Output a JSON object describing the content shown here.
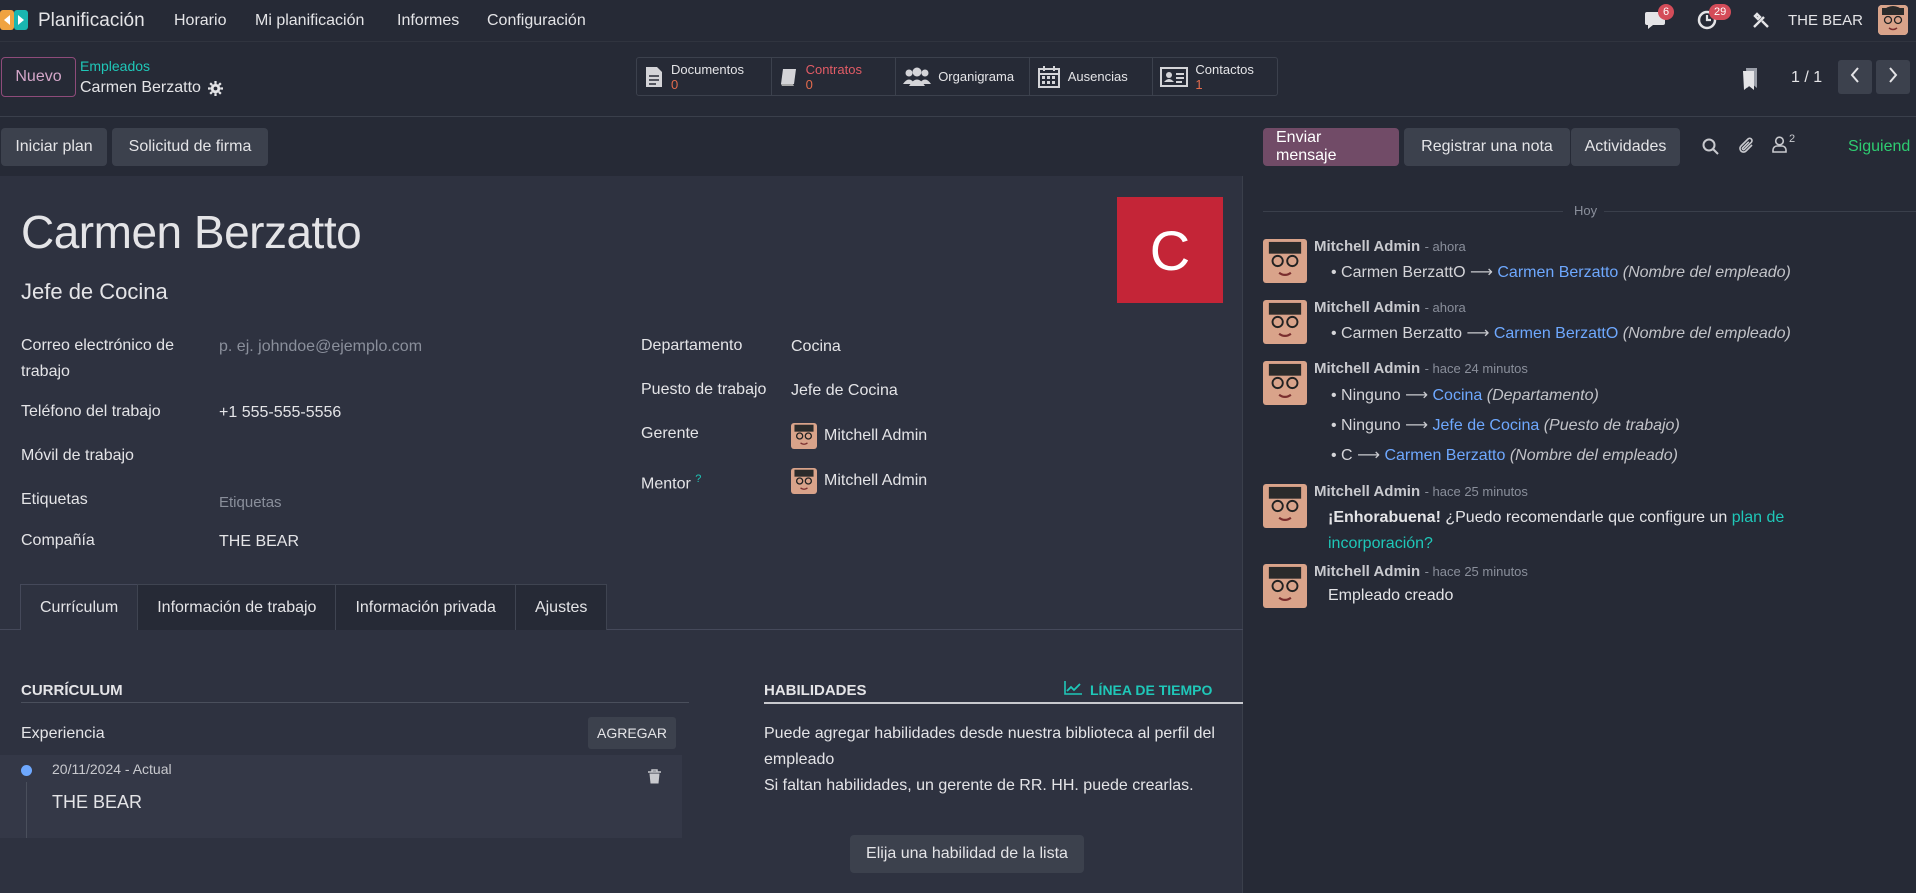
{
  "topnav": {
    "app_name": "Planificación",
    "menu": [
      "Horario",
      "Mi planificación",
      "Informes",
      "Configuración"
    ],
    "chat_count": "6",
    "activity_count": "29",
    "company": "THE BEAR"
  },
  "control": {
    "new_label": "Nuevo",
    "breadcrumb_parent": "Empleados",
    "breadcrumb_current": "Carmen Berzatto",
    "smart_buttons": [
      {
        "label": "Documentos",
        "count": "0",
        "icon": "document-icon",
        "accent": false
      },
      {
        "label": "Contratos",
        "count": "0",
        "icon": "book-icon",
        "accent": true
      },
      {
        "label": "Organigrama",
        "count": "",
        "icon": "users-icon",
        "accent": false
      },
      {
        "label": "Ausencias",
        "count": "",
        "icon": "calendar-icon",
        "accent": false
      },
      {
        "label": "Contactos",
        "count": "1",
        "icon": "id-card-icon",
        "accent": false
      }
    ],
    "pager": "1 / 1"
  },
  "actions": {
    "start_plan": "Iniciar plan",
    "signature_request": "Solicitud de firma"
  },
  "chatter_actions": {
    "send_message": "Enviar mensaje",
    "log_note": "Registrar una nota",
    "activities": "Actividades",
    "followers_count": "2",
    "following": "Siguiend"
  },
  "employee": {
    "name": "Carmen Berzatto",
    "job_title": "Jefe de Cocina",
    "avatar_letter": "C",
    "avatar_color": "#c42537",
    "left_fields": [
      {
        "label": "Correo electrónico de trabajo",
        "value": "",
        "placeholder": "p. ej. johndoe@ejemplo.com"
      },
      {
        "label": "Teléfono del trabajo",
        "value": "+1 555-555-5556",
        "placeholder": ""
      },
      {
        "label": "Móvil de trabajo",
        "value": "",
        "placeholder": ""
      },
      {
        "label": "Etiquetas",
        "value": "",
        "placeholder": "Etiquetas"
      },
      {
        "label": "Compañía",
        "value": "THE BEAR",
        "placeholder": ""
      }
    ],
    "department_label": "Departamento",
    "department": "Cocina",
    "job_position_label": "Puesto de trabajo",
    "job_position": "Jefe de Cocina",
    "manager_label": "Gerente",
    "manager": "Mitchell Admin",
    "mentor_label": "Mentor",
    "mentor_help": "?",
    "mentor": "Mitchell Admin"
  },
  "tabs": [
    "Currículum",
    "Información de trabajo",
    "Información privada",
    "Ajustes"
  ],
  "resume": {
    "section_title": "CURRÍCULUM",
    "experience_label": "Experiencia",
    "add_label": "AGREGAR",
    "entry_date": "20/11/2024 - Actual",
    "entry_title": "THE BEAR"
  },
  "skills": {
    "title": "HABILIDADES",
    "timeline_label": "LÍNEA DE TIEMPO",
    "help_line1": "Puede agregar habilidades desde nuestra biblioteca al perfil del empleado",
    "help_line2": "Si faltan habilidades, un gerente de RR. HH. puede crearlas.",
    "pick_label": "Elija una habilidad de la lista"
  },
  "chatter": {
    "date_separator": "Hoy",
    "messages": [
      {
        "author": "Mitchell Admin",
        "when": "- ahora",
        "changes": [
          {
            "old": "Carmen BerzattO",
            "new": "Carmen Berzatto",
            "field": "(Nombre del empleado)"
          }
        ]
      },
      {
        "author": "Mitchell Admin",
        "when": "- ahora",
        "changes": [
          {
            "old": "Carmen Berzatto",
            "new": "Carmen BerzattO",
            "field": "(Nombre del empleado)"
          }
        ]
      },
      {
        "author": "Mitchell Admin",
        "when": "- hace 24 minutos",
        "changes": [
          {
            "old": "Ninguno",
            "new": "Cocina",
            "field": "(Departamento)"
          },
          {
            "old": "Ninguno",
            "new": "Jefe de Cocina",
            "field": "(Puesto de trabajo)"
          },
          {
            "old": "C",
            "new": "Carmen Berzatto",
            "field": "(Nombre del empleado)"
          }
        ]
      },
      {
        "author": "Mitchell Admin",
        "when": "- hace 25 minutos",
        "bold": "¡Enhorabuena!",
        "text": "¿Puedo recomendarle que configure un",
        "link": "plan de incorporación?"
      },
      {
        "author": "Mitchell Admin",
        "when": "- hace 25 minutos",
        "text": "Empleado creado"
      }
    ]
  }
}
